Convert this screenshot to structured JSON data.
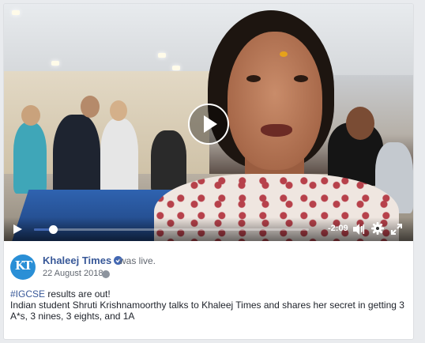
{
  "video": {
    "time_remaining": "-2:09",
    "progress_fraction": 0.07,
    "accent_color": "#4267b2"
  },
  "post": {
    "page_name": "Khaleej Times",
    "status_text": "was live.",
    "date": "22 August 2018",
    "hashtag": "#IGCSE",
    "headline_rest": " results are out!",
    "body": "Indian student Shruti Krishnamoorthy talks to Khaleej Times and shares her secret in getting 3 A*s, 3 nines, 3 eights, and 1A",
    "avatar_text": "KT",
    "link_color": "#385898"
  },
  "icons": {
    "play": "play-icon",
    "volume": "volume-icon",
    "settings": "gear-icon",
    "fullscreen": "fullscreen-icon",
    "verified": "verified-badge-icon",
    "audience": "globe-icon"
  }
}
